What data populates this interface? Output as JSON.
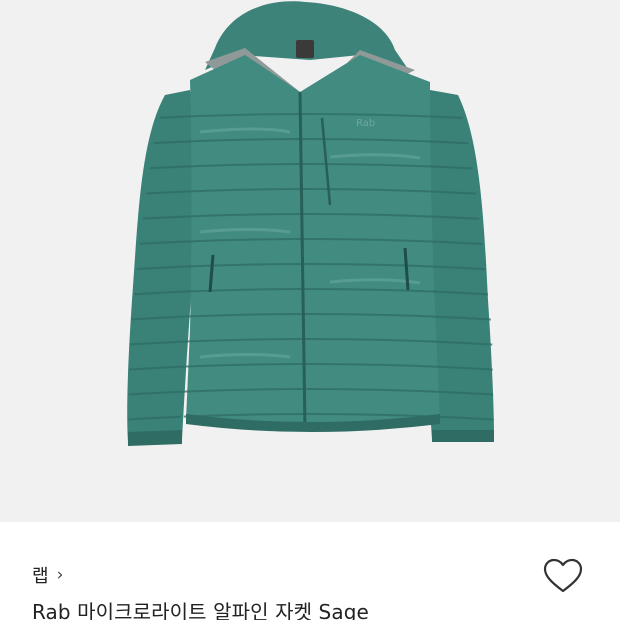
{
  "product": {
    "brand": "랩",
    "brand_chevron": "›",
    "title": "Rab 마이크로라이트 알파인 자켓 Sage"
  },
  "colors": {
    "jacket": "#3f8a80",
    "jacket_dark": "#2e6d64",
    "hood_lining": "#8f9a98",
    "image_bg": "#f1f1f1"
  },
  "icons": {
    "like": "heart-icon",
    "brand_arrow": "chevron-right-icon"
  }
}
